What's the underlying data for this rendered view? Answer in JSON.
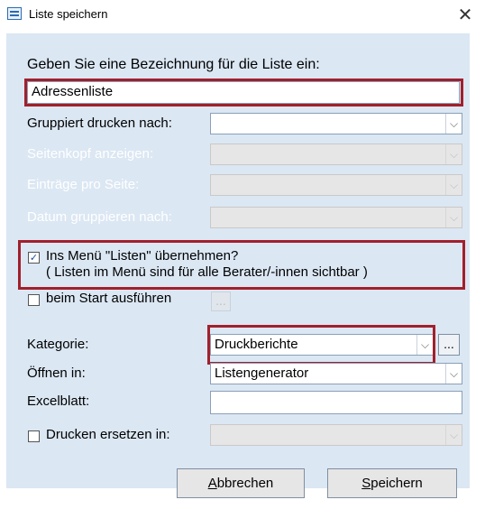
{
  "window": {
    "title": "Liste speichern",
    "close_glyph": "✕"
  },
  "form": {
    "prompt": "Geben Sie eine Bezeichnung für die Liste ein:",
    "name_value": "Adressenliste",
    "rows": [
      {
        "label": "Gruppiert drucken nach:",
        "value": "",
        "enabled": true
      },
      {
        "label": "Seitenkopf anzeigen:",
        "value": "",
        "enabled": false
      },
      {
        "label": "Einträge pro Seite:",
        "value": "",
        "enabled": false
      },
      {
        "label": "Datum gruppieren nach:",
        "value": "",
        "enabled": false
      }
    ],
    "menu_checkbox": {
      "checked": true,
      "line1": "Ins Menü \"Listen\" übernehmen?",
      "line2": "( Listen im Menü sind für alle Berater/-innen sichtbar )"
    },
    "start_checkbox": {
      "checked": false,
      "label": "beim Start ausführen",
      "button": "..."
    },
    "kategorie": {
      "label": "Kategorie:",
      "value": "Druckberichte",
      "button": "..."
    },
    "oeffnen": {
      "label": "Öffnen in:",
      "value": "Listengenerator"
    },
    "excel": {
      "label": "Excelblatt:",
      "value": ""
    },
    "drucken": {
      "checked": false,
      "label": "Drucken ersetzen in:",
      "value": ""
    }
  },
  "buttons": {
    "cancel": {
      "mnemonic": "A",
      "rest": "bbrechen"
    },
    "save": {
      "mnemonic": "S",
      "rest": "peichern"
    }
  },
  "colors": {
    "panel": "#dbe7f3",
    "highlight": "#a1202c",
    "disabled_text": "#ffffff"
  },
  "icons": [
    "list-window-icon",
    "close-icon",
    "chevron-down-icon",
    "check-icon"
  ]
}
